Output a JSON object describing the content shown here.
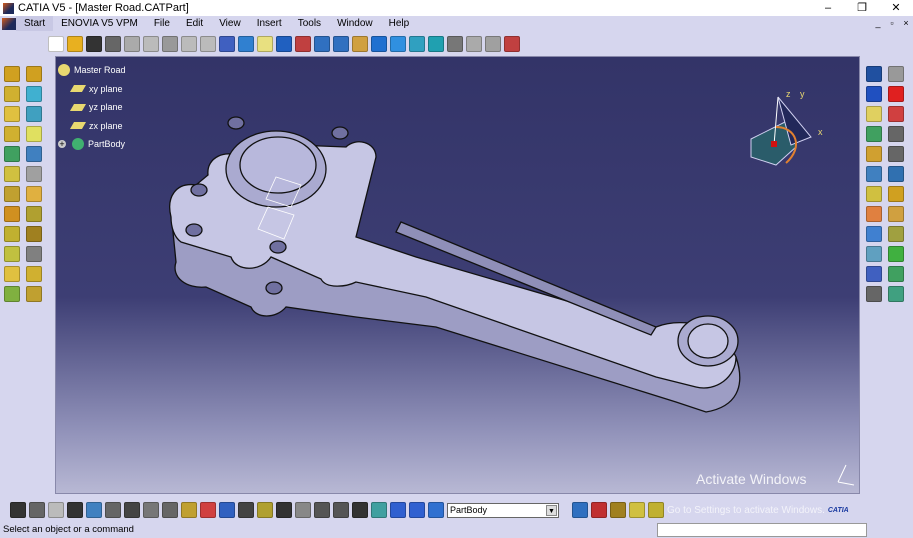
{
  "window": {
    "title": "CATIA V5 - [Master Road.CATPart]",
    "minimize": "–",
    "restore": "❐",
    "close": "✕"
  },
  "menu": {
    "items": [
      "Start",
      "ENOVIA V5 VPM",
      "File",
      "Edit",
      "View",
      "Insert",
      "Tools",
      "Window",
      "Help"
    ],
    "mdi": [
      "_",
      "▫",
      "×"
    ]
  },
  "tree": {
    "root": "Master Road",
    "children": [
      "xy plane",
      "yz plane",
      "zx plane"
    ],
    "body": "PartBody"
  },
  "compass": {
    "x": "x",
    "y": "y",
    "z": "z"
  },
  "bottom_toolbar": {
    "current_body": "PartBody",
    "dropdown_arrow": "▼",
    "logo": "CATIA"
  },
  "watermark": {
    "line1": "Activate Windows",
    "line2": "Go to Settings to activate Windows."
  },
  "status": {
    "message": "Select an object or a command",
    "command_input": ""
  },
  "icons": {
    "top": [
      [
        "new-icon",
        "#fff"
      ],
      [
        "open-icon",
        "#e8b020"
      ],
      [
        "save-icon",
        "#333"
      ],
      [
        "print-icon",
        "#666"
      ],
      [
        "cut-icon",
        "#aaa"
      ],
      [
        "copy-icon",
        "#bbb"
      ],
      [
        "paste-icon",
        "#999"
      ],
      [
        "undo-icon",
        "#bbb"
      ],
      [
        "redo-icon",
        "#bbb"
      ],
      [
        "whats-this-icon",
        "#4060c0"
      ],
      [
        "fly-mode-icon",
        "#3080d0"
      ],
      [
        "fit-all-icon",
        "#e8e080"
      ],
      [
        "pan-icon",
        "#2060c0"
      ],
      [
        "rotate-icon",
        "#c04040"
      ],
      [
        "zoom-in-icon",
        "#3070c0"
      ],
      [
        "zoom-out-icon",
        "#3070c0"
      ],
      [
        "normal-view-icon",
        "#d0a040"
      ],
      [
        "iso-view-icon",
        "#2070d0"
      ],
      [
        "shading-icon",
        "#3090e0"
      ],
      [
        "hide-show-icon",
        "#30a0c0"
      ],
      [
        "swap-space-icon",
        "#20a0b0"
      ],
      [
        "sketcher-icon",
        "#777"
      ],
      [
        "measure-icon",
        "#aaa"
      ],
      [
        "grid-icon",
        "#a0a0a0"
      ],
      [
        "catalog-icon",
        "#c04040"
      ]
    ],
    "left": [
      [
        "pad-icon",
        "#d0a020"
      ],
      [
        "pocket-icon",
        "#d0a020"
      ],
      [
        "shaft-icon",
        "#d0b030"
      ],
      [
        "groove-icon",
        "#40b0d0"
      ],
      [
        "hole-icon",
        "#e0c040"
      ],
      [
        "rib-icon",
        "#40a0c0"
      ],
      [
        "slot-icon",
        "#d0b030"
      ],
      [
        "stiffener-icon",
        "#e0e060"
      ],
      [
        "loft-icon",
        "#40a060"
      ],
      [
        "remove-loft-icon",
        "#4080c0"
      ],
      [
        "fillet-icon",
        "#d0c040"
      ],
      [
        "chamfer-icon",
        "#a0a0a0"
      ],
      [
        "draft-icon",
        "#c0a030"
      ],
      [
        "shell-icon",
        "#e0b040"
      ],
      [
        "thickness-icon",
        "#d09020"
      ],
      [
        "thread-icon",
        "#b0a030"
      ],
      [
        "split-icon",
        "#c0b030"
      ],
      [
        "mirror-icon",
        "#a08020"
      ],
      [
        "pattern-icon",
        "#c0c040"
      ],
      [
        "scale-icon",
        "#808080"
      ],
      [
        "boolean-icon",
        "#e0c040"
      ],
      [
        "assemble-icon",
        "#d0b030"
      ],
      [
        "intersect-icon",
        "#80b040"
      ],
      [
        "union-icon",
        "#c0a030"
      ]
    ],
    "right": [
      [
        "point-icon",
        "#2050a0"
      ],
      [
        "settings-icon",
        "#999"
      ],
      [
        "line-icon",
        "#2050c0"
      ],
      [
        "delete-icon",
        "#e02020"
      ],
      [
        "plane-icon",
        "#e0d060"
      ],
      [
        "pdf-icon",
        "#d04040"
      ],
      [
        "body-icon",
        "#40a060"
      ],
      [
        "sketch-icon",
        "#666"
      ],
      [
        "axis-icon",
        "#d0a030"
      ],
      [
        "positioned-sketch-icon",
        "#666"
      ],
      [
        "constraint-icon",
        "#4080c0"
      ],
      [
        "cube-icon",
        "#3070b0"
      ],
      [
        "analysis-icon",
        "#d0c040"
      ],
      [
        "draft-analysis-icon",
        "#d0a020"
      ],
      [
        "select-icon",
        "#e08040"
      ],
      [
        "apply-material-icon",
        "#d0a040"
      ],
      [
        "render-icon",
        "#4080d0"
      ],
      [
        "transform-icon",
        "#a0a040"
      ],
      [
        "measure-between-icon",
        "#60a0c0"
      ],
      [
        "inertia-icon",
        "#40b040"
      ],
      [
        "pattern-grid-icon",
        "#4060c0"
      ],
      [
        "scan-icon",
        "#40a060"
      ],
      [
        "snap-icon",
        "#666"
      ],
      [
        "graph-icon",
        "#40a080"
      ]
    ],
    "bottom": [
      [
        "formula-icon",
        "#333"
      ],
      [
        "knowledge-icon",
        "#666"
      ],
      [
        "param-icon",
        "#bbb"
      ],
      [
        "table-icon",
        "#333"
      ],
      [
        "tree-icon",
        "#4080c0"
      ],
      [
        "law-icon",
        "#666"
      ],
      [
        "check-icon",
        "#444"
      ],
      [
        "publish-icon",
        "#777"
      ],
      [
        "annotation-icon",
        "#666"
      ],
      [
        "3d-text-icon",
        "#c0a030"
      ],
      [
        "flag-icon",
        "#d04040"
      ],
      [
        "dimension-icon",
        "#3060c0"
      ],
      [
        "explode-icon",
        "#444"
      ],
      [
        "thread-display-icon",
        "#b0a030"
      ],
      [
        "camera-icon",
        "#333"
      ],
      [
        "spiral-icon",
        "#888"
      ],
      [
        "hand-icon",
        "#555"
      ],
      [
        "axis-system-icon",
        "#555"
      ],
      [
        "numbers-icon",
        "#333"
      ],
      [
        "body-insert-icon",
        "#40a0a0"
      ],
      [
        "ordered-set-icon",
        "#3060d0"
      ],
      [
        "geometric-set-icon",
        "#3060d0"
      ],
      [
        "part-body-icon",
        "#3070d0"
      ]
    ],
    "bottom2": [
      [
        "material-icon",
        "#3070c0"
      ],
      [
        "photo-studio-icon",
        "#c03030"
      ],
      [
        "environment-icon",
        "#a08020"
      ],
      [
        "update-icon",
        "#d0c040"
      ],
      [
        "knowledge-advisor-icon",
        "#c0b030"
      ]
    ]
  }
}
